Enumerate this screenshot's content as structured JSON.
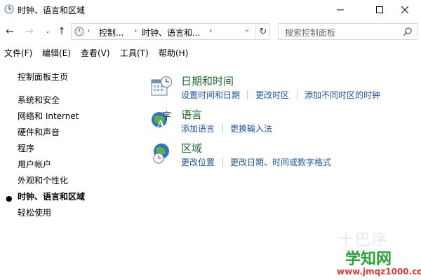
{
  "window": {
    "title": "时钟、语言和区域",
    "minimize_icon": "minimize-icon",
    "maximize_icon": "maximize-icon",
    "close_icon": "close-icon"
  },
  "address_bar": {
    "crumbs": [
      "控制...",
      "时钟、语言和..."
    ],
    "refresh_icon": "refresh-icon"
  },
  "search": {
    "placeholder": "搜索控制面板"
  },
  "menu": [
    "文件(F)",
    "编辑(E)",
    "查看(V)",
    "工具(T)",
    "帮助(H)"
  ],
  "sidebar": {
    "home": "控制面板主页",
    "items": [
      "系统和安全",
      "网络和 Internet",
      "硬件和声音",
      "程序",
      "用户帐户",
      "外观和个性化",
      "时钟、语言和区域",
      "轻松使用"
    ],
    "active_index": 6
  },
  "categories": [
    {
      "title": "日期和时间",
      "icon": "calendar-clock-icon",
      "links": [
        "设置时间和日期",
        "更改时区",
        "添加不同时区的时钟"
      ]
    },
    {
      "title": "语言",
      "icon": "language-icon",
      "links": [
        "添加语言",
        "更换输入法"
      ]
    },
    {
      "title": "区域",
      "icon": "globe-clock-icon",
      "links": [
        "更改位置",
        "更改日期、时间或数字格式"
      ]
    }
  ],
  "colors": {
    "category_title": "#1e6b2e",
    "link": "#1a56a6",
    "watermark_green": "#29a337",
    "watermark_red": "#e53935"
  },
  "watermark": {
    "logo": "学知网",
    "url": "www.jmqz1000.com"
  }
}
